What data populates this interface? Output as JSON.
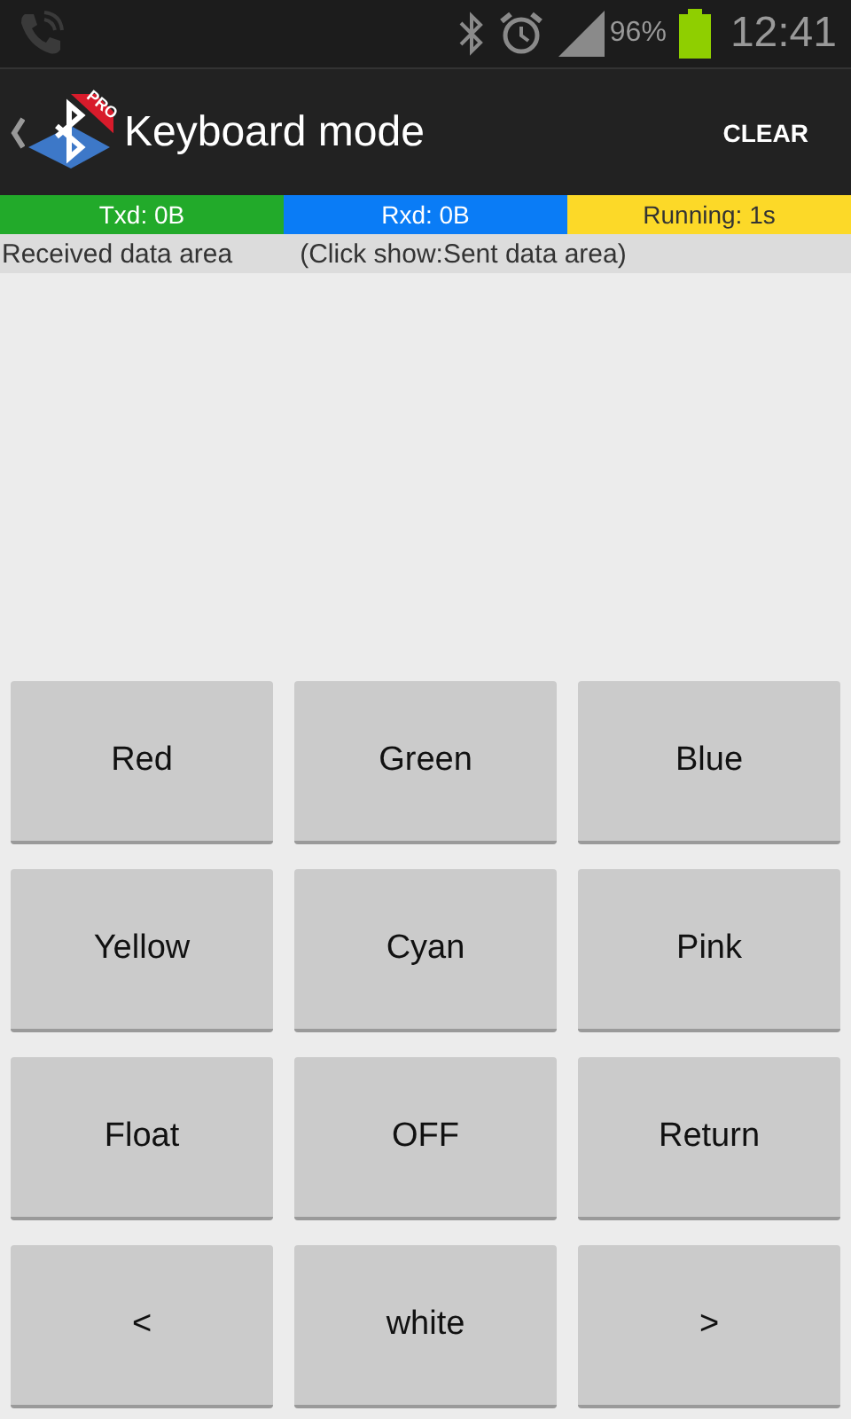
{
  "status_bar": {
    "battery_text": "96%",
    "time": "12:41"
  },
  "action_bar": {
    "logo_badge": "PRO",
    "title": "Keyboard mode",
    "action": "CLEAR"
  },
  "stats": [
    {
      "label": "Txd: 0B",
      "color": "#22aa2a"
    },
    {
      "label": "Rxd: 0B",
      "color": "#0a7cf6"
    },
    {
      "label": "Running: 1s",
      "color": "#fcd928"
    }
  ],
  "info": {
    "left": "Received data area",
    "right": "(Click show:Sent data area)"
  },
  "keys": [
    "Red",
    "Green",
    "Blue",
    "Yellow",
    "Cyan",
    "Pink",
    "Float",
    "OFF",
    "Return",
    "<",
    "white",
    ">"
  ]
}
